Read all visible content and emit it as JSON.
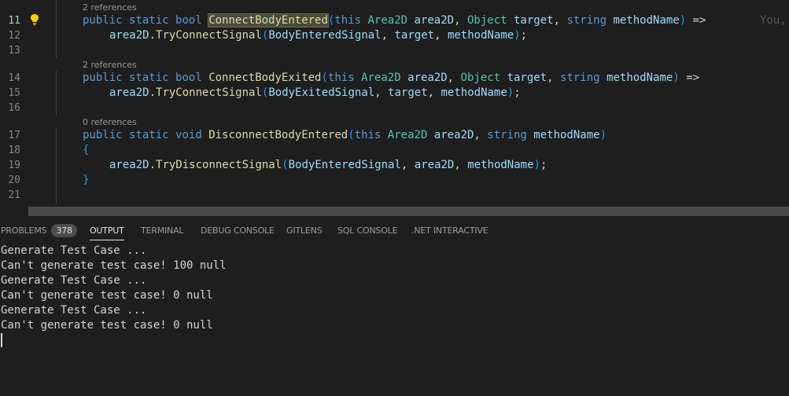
{
  "editor": {
    "line_numbers": [
      "11",
      "12",
      "13",
      "14",
      "15",
      "16",
      "17",
      "18",
      "19",
      "20",
      "21"
    ],
    "lens": {
      "l11": "2 references",
      "l14": "2 references",
      "l17": "0 references"
    },
    "code": {
      "l11": {
        "kw1": "public",
        "kw2": "static",
        "kw3": "bool",
        "fn": "ConnectBodyEntered",
        "open": "(",
        "kw4": "this",
        "type1": "Area2D",
        "p1": "area2D",
        "c1": ",",
        "type2": "Object",
        "p2": "target",
        "c2": ",",
        "kw5": "string",
        "p3": "methodName",
        "close": ")",
        "arrow": "=>"
      },
      "l12": {
        "obj": "area2D",
        "dot": ".",
        "fn": "TryConnectSignal",
        "open": "(",
        "a1": "BodyEnteredSignal",
        "c1": ",",
        "a2": "target",
        "c2": ",",
        "a3": "methodName",
        "close": ")",
        "semi": ";"
      },
      "l14": {
        "kw1": "public",
        "kw2": "static",
        "kw3": "bool",
        "fn": "ConnectBodyExited",
        "open": "(",
        "kw4": "this",
        "type1": "Area2D",
        "p1": "area2D",
        "c1": ",",
        "type2": "Object",
        "p2": "target",
        "c2": ",",
        "kw5": "string",
        "p3": "methodName",
        "close": ")",
        "arrow": "=>"
      },
      "l15": {
        "obj": "area2D",
        "dot": ".",
        "fn": "TryConnectSignal",
        "open": "(",
        "a1": "BodyExitedSignal",
        "c1": ",",
        "a2": "target",
        "c2": ",",
        "a3": "methodName",
        "close": ")",
        "semi": ";"
      },
      "l17": {
        "kw1": "public",
        "kw2": "static",
        "kw3": "void",
        "fn": "DisconnectBodyEntered",
        "open": "(",
        "kw4": "this",
        "type1": "Area2D",
        "p1": "area2D",
        "c1": ",",
        "kw5": "string",
        "p3": "methodName",
        "close": ")"
      },
      "l18": {
        "brace": "{"
      },
      "l19": {
        "obj": "area2D",
        "dot": ".",
        "fn": "TryDisconnectSignal",
        "open": "(",
        "a1": "BodyEnteredSignal",
        "c1": ",",
        "a2": "area2D",
        "c2": ",",
        "a3": "methodName",
        "close": ")",
        "semi": ";"
      },
      "l20": {
        "brace": "}"
      }
    },
    "blame_ghost": "You,"
  },
  "panel": {
    "tabs": {
      "problems": "PROBLEMS",
      "problems_count": "378",
      "output": "OUTPUT",
      "terminal": "TERMINAL",
      "debug_console": "DEBUG CONSOLE",
      "gitlens": "GITLENS",
      "sql_console": "SQL CONSOLE",
      "net_interactive": ".NET INTERACTIVE"
    },
    "output_lines": [
      "Generate Test Case ...",
      "Can't generate test case! 100 null",
      "Generate Test Case ...",
      "Can't generate test case! 0 null",
      "Generate Test Case ...",
      "Can't generate test case! 0 null"
    ]
  },
  "colors": {
    "background": "#1e1e1e",
    "keyword": "#569cd6",
    "function": "#dcdcaa",
    "type": "#4ec9b0",
    "variable": "#9cdcfe",
    "bracket": "#179fff",
    "lightbulb": "#ffcc00"
  },
  "icons": {
    "code_action": "lightbulb-icon"
  }
}
